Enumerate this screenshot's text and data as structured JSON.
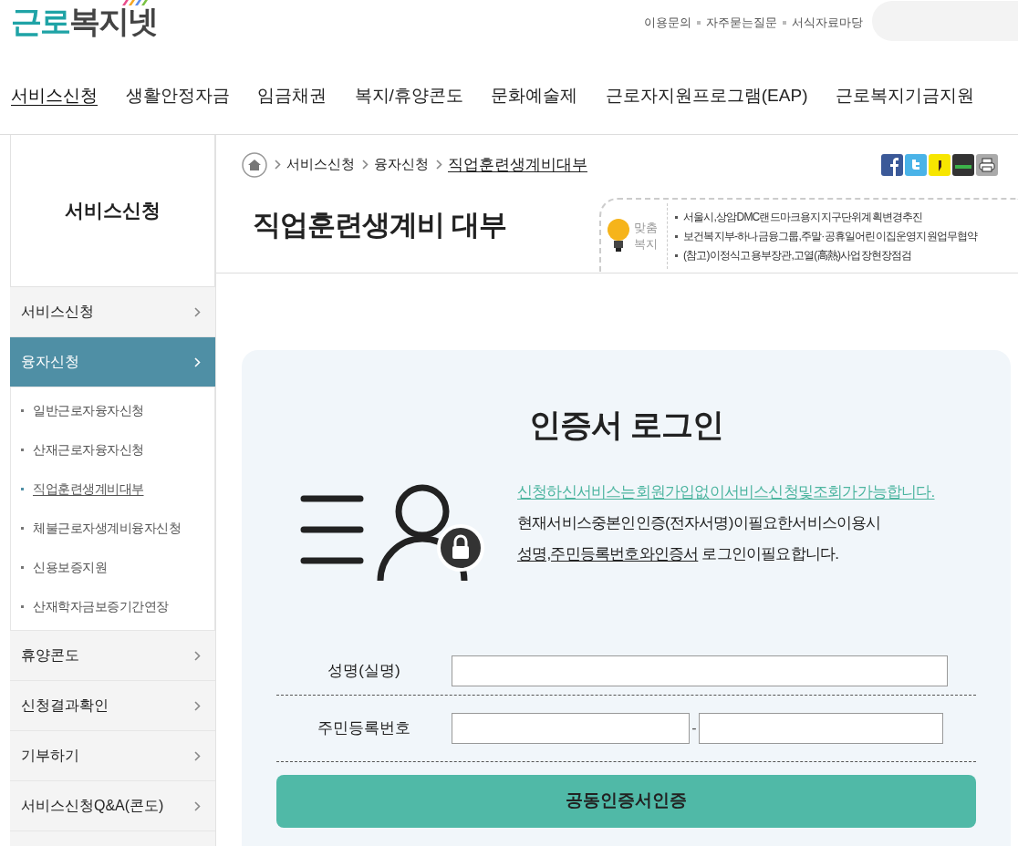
{
  "logo": {
    "accent": "근로",
    "rest": "복지넷"
  },
  "top_links": [
    "이용문의",
    "자주묻는질문",
    "서식자료마당"
  ],
  "nav": [
    {
      "label": "서비스신청",
      "selected": true
    },
    {
      "label": "생활안정자금",
      "selected": false
    },
    {
      "label": "임금채권",
      "selected": false
    },
    {
      "label": "복지/휴양콘도",
      "selected": false
    },
    {
      "label": "문화예술제",
      "selected": false
    },
    {
      "label": "근로자지원프로그램(EAP)",
      "selected": false
    },
    {
      "label": "근로복지기금지원",
      "selected": false
    }
  ],
  "sidebar": {
    "title": "서비스신청",
    "items": [
      {
        "label": "서비스신청",
        "selected": false
      },
      {
        "label": "융자신청",
        "selected": true,
        "expanded": true,
        "children": [
          {
            "label": "일반근로자융자신청",
            "selected": false
          },
          {
            "label": "산재근로자융자신청",
            "selected": false
          },
          {
            "label": "직업훈련생계비대부",
            "selected": true
          },
          {
            "label": "체불근로자생계비융자신청",
            "selected": false
          },
          {
            "label": "신용보증지원",
            "selected": false
          },
          {
            "label": "산재학자금보증기간연장",
            "selected": false
          }
        ]
      },
      {
        "label": "휴양콘도",
        "selected": false
      },
      {
        "label": "신청결과확인",
        "selected": false
      },
      {
        "label": "기부하기",
        "selected": false
      },
      {
        "label": "서비스신청Q&A(콘도)",
        "selected": false
      }
    ]
  },
  "breadcrumb": [
    "서비스신청",
    "융자신청",
    "직업훈련생계비대부"
  ],
  "page_title": "직업훈련생계비 대부",
  "notice": {
    "badge": [
      "맞춤",
      "복지"
    ],
    "items": [
      "서울시,상암DMC랜드마크용지지구단위계획변경추진",
      "보건복지부-하나금융그룹,주말·공휴일어린이집운영지원업무협약",
      "(참고)이정식고용부장관,고열(高熱)사업장현장점검"
    ]
  },
  "login": {
    "title": "인증서 로그인",
    "lead": "신청하신서비스는회원가입없이서비스신청및조회가가능합니다.",
    "line2": "현재서비스중본인인증(전자서명)이필요한서비스이용시",
    "line3_underlined": "성명,주민등록번호와인증서",
    "line3_rest": "로그인이필요합니다.",
    "name_label": "성명(실명)",
    "id_label": "주민등록번호",
    "id_separator": "-",
    "submit": "공동인증서인증"
  }
}
